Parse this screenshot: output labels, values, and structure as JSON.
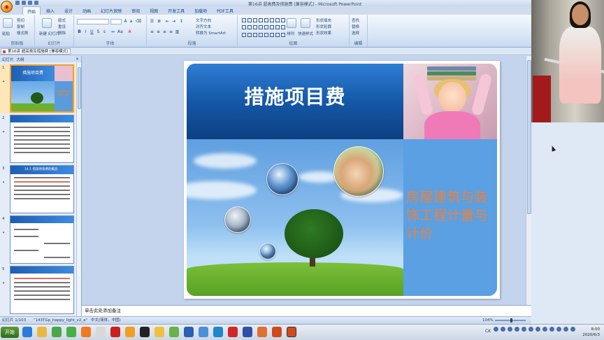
{
  "window": {
    "title": "第16讲 超高费及措施费 [兼容模式] - Microsoft PowerPoint"
  },
  "ribbon": {
    "tabs": [
      "开始",
      "插入",
      "设计",
      "动画",
      "幻灯片放映",
      "审阅",
      "视图",
      "开发工具",
      "加载项",
      "PDF工具"
    ],
    "groups": [
      "剪贴板",
      "幻灯片",
      "字体",
      "段落",
      "绘图",
      "编辑"
    ],
    "clipboard": {
      "paste": "粘贴",
      "cut": "剪切",
      "copy": "复制",
      "format_painter": "格式刷"
    },
    "slides": {
      "new_slide": "新建\n幻灯片",
      "layout": "版式",
      "reset": "重设",
      "delete": "删除"
    },
    "paragraph": {
      "text_direction": "文字方向",
      "align_text": "对齐文本",
      "smartart": "转换为 SmartArt"
    },
    "drawing": {
      "arrange": "排列",
      "quick_styles": "快速样式",
      "shape_fill": "形状填充",
      "shape_outline": "形状轮廓",
      "shape_effects": "形状效果"
    },
    "editing": {
      "find": "查找",
      "replace": "替换",
      "select": "选择"
    }
  },
  "doc_tab": {
    "label": "第16讲 超高费及措施费 [兼容模式]"
  },
  "left_pane": {
    "tabs": [
      "幻灯片",
      "大纲"
    ],
    "close": "×",
    "thumbnails": [
      {
        "num": "1",
        "title": "措施项目费",
        "selected": true
      },
      {
        "num": "2",
        "title": "",
        "selected": false
      },
      {
        "num": "3",
        "title": "14.1 措施项目费的概念",
        "selected": false
      },
      {
        "num": "4",
        "title": "",
        "selected": false
      },
      {
        "num": "5",
        "title": "",
        "selected": false
      }
    ]
  },
  "slide": {
    "title": "措施项目费",
    "side_text": "房屋建筑与装饰工程计量与计价"
  },
  "notes": {
    "placeholder": "单击此处添加备注"
  },
  "status": {
    "slide_info": "幻灯片 1/103",
    "theme": "\"143TGp_happy_light_v2_a\"",
    "language": "中文(简体，中国)",
    "zoom": "104%"
  },
  "taskbar": {
    "start": "开始",
    "tray_label": "CK",
    "time": "8:00",
    "date": "2020/6/3"
  },
  "colors": {
    "ribbon_bg": "#d6e4f5",
    "slide_title_bg": "#1558a8",
    "side_panel": "#5aa0e3",
    "orange_text": "#f0803a"
  }
}
